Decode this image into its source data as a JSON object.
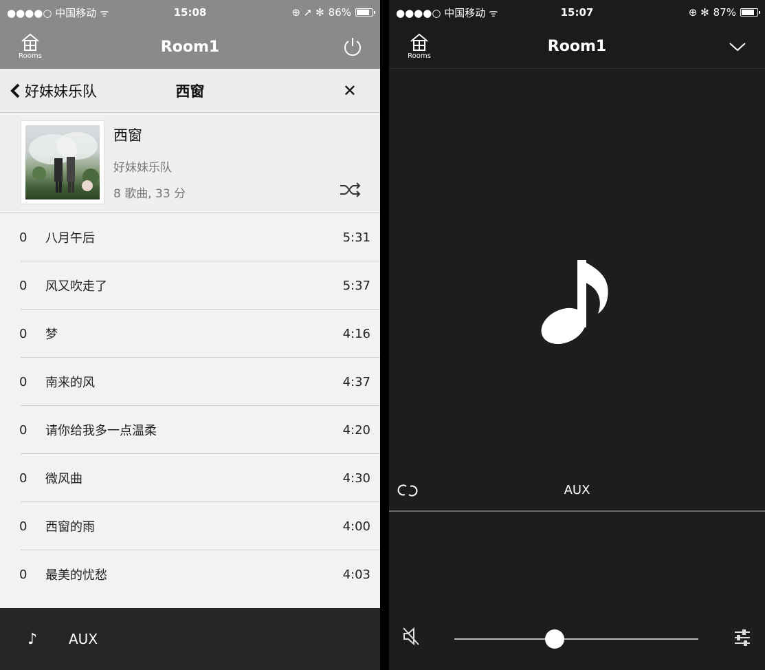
{
  "left": {
    "status": {
      "carrier": "●●●●○ 中国移动 ᯤ",
      "time": "15:08",
      "icons": "⊕ ➚ ✻",
      "battery": "86%",
      "battery_level": 0.86
    },
    "nav": {
      "rooms_label": "Rooms",
      "title": "Room1",
      "power_icon": "power-icon"
    },
    "sub": {
      "back_label": "好妹妹乐队",
      "title": "西窗",
      "close": "✕"
    },
    "album": {
      "title": "西窗",
      "artist": "好妹妹乐队",
      "meta": "8 歌曲, 33 分"
    },
    "tracks": [
      {
        "num": "0",
        "name": "八月午后",
        "dur": "5:31"
      },
      {
        "num": "0",
        "name": "风又吹走了",
        "dur": "5:37"
      },
      {
        "num": "0",
        "name": "梦",
        "dur": "4:16"
      },
      {
        "num": "0",
        "name": "南来的风",
        "dur": "4:37"
      },
      {
        "num": "0",
        "name": "请你给我多一点温柔",
        "dur": "4:20"
      },
      {
        "num": "0",
        "name": "微风曲",
        "dur": "4:30"
      },
      {
        "num": "0",
        "name": "西窗的雨",
        "dur": "4:00"
      },
      {
        "num": "0",
        "name": "最美的忧愁",
        "dur": "4:03"
      }
    ],
    "footer": {
      "note": "♪",
      "source": "AUX"
    }
  },
  "right": {
    "status": {
      "carrier": "●●●●○ 中国移动 ᯤ",
      "time": "15:07",
      "icons": "⊕ ✻",
      "battery": "87%",
      "battery_level": 0.87
    },
    "nav": {
      "rooms_label": "Rooms",
      "title": "Room1"
    },
    "source": "AUX",
    "volume": 0.41
  },
  "colors": {
    "light_bg": "#f2f2f2",
    "header_gray": "#8a8a8a",
    "dark_bg": "#1c1d1f",
    "footer_dark": "#262626"
  }
}
